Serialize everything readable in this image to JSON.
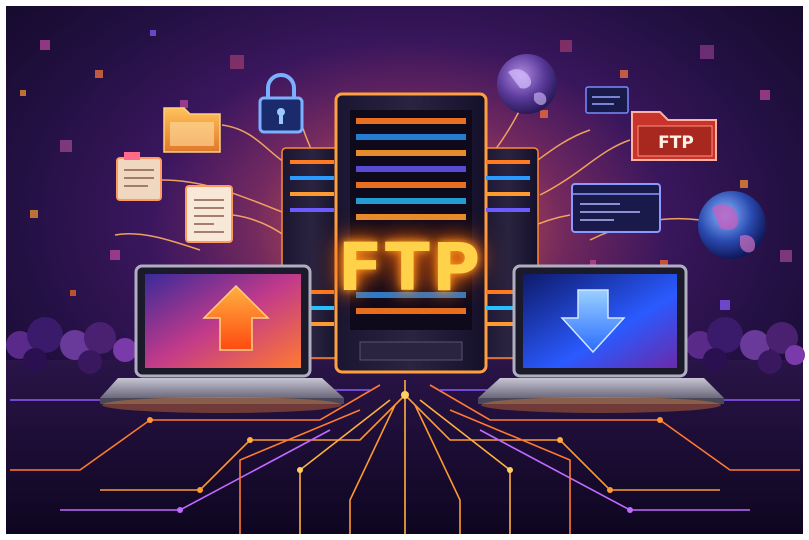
{
  "scene": {
    "main_label": "FTP",
    "folder_label": "FTP",
    "colors": {
      "background": "#1e0f3e",
      "glow_orange": "#ff8a1a",
      "circuit_orange": "#ff9a30",
      "circuit_purple": "#8a5cff",
      "screen_blue": "#2a6cff",
      "upload_arrow": "#ff6a10",
      "download_arrow": "#3a8cff"
    },
    "icons": [
      "server-rack-icon",
      "padlock-icon",
      "folder-icon",
      "document-icon",
      "globe-icon",
      "ftp-folder-icon",
      "browser-window-icon",
      "laptop-upload-icon",
      "laptop-download-icon",
      "upload-arrow-icon",
      "download-arrow-icon"
    ]
  }
}
